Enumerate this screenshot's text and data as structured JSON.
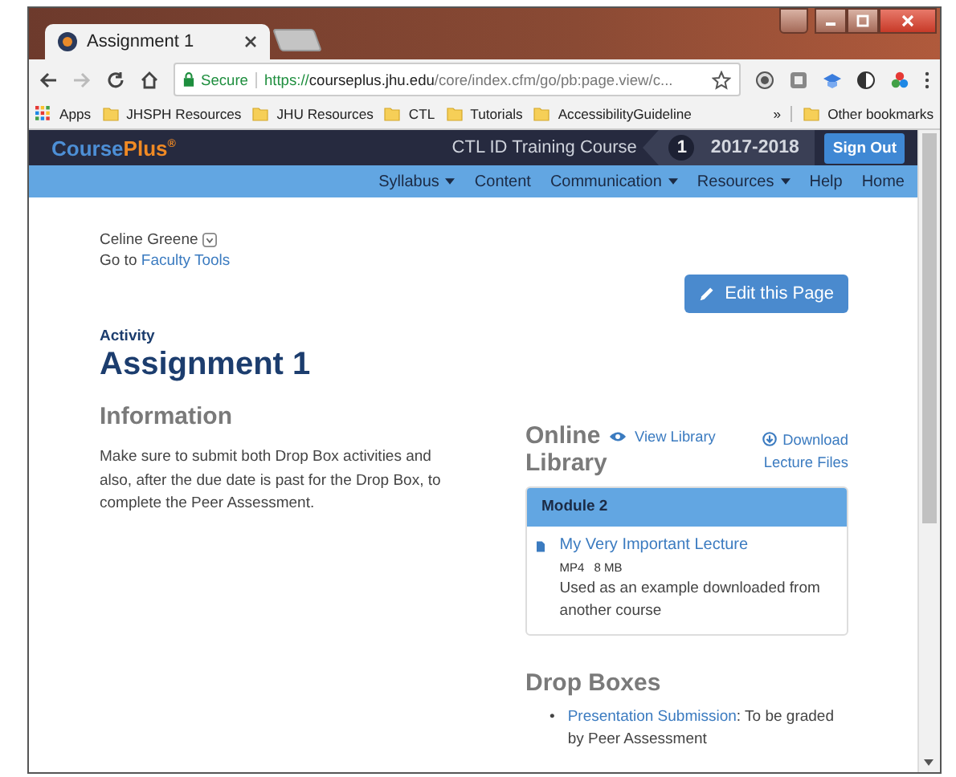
{
  "browser": {
    "tabs": [
      {
        "title": "Assignment 1",
        "selected": true
      },
      {
        "kind": "new",
        "selected": false
      }
    ],
    "address": {
      "secure_label": "Secure",
      "scheme": "https://",
      "host": "courseplus.jhu.edu",
      "path": "/core/index.cfm/go/pb:page.view/c..."
    },
    "bookmarks": [
      {
        "label": "Apps",
        "kind": "apps"
      },
      {
        "label": "JHSPH Resources",
        "kind": "folder"
      },
      {
        "label": "JHU Resources",
        "kind": "folder"
      },
      {
        "label": "CTL",
        "kind": "folder"
      },
      {
        "label": "Tutorials",
        "kind": "folder"
      },
      {
        "label": "AccessibilityGuideline",
        "kind": "folder"
      }
    ],
    "overflow": "»",
    "other_bookmarks": "Other bookmarks"
  },
  "site": {
    "logo": {
      "name": "Course",
      "accent": "Plus",
      "mark": "®"
    },
    "course": "CTL ID Training Course",
    "term_number": "1",
    "term": "2017-2018",
    "sign_out": "Sign Out",
    "nav": [
      {
        "label": "Syllabus",
        "dropdown": true
      },
      {
        "label": "Content",
        "dropdown": false
      },
      {
        "label": "Communication",
        "dropdown": true
      },
      {
        "label": "Resources",
        "dropdown": true
      },
      {
        "label": "Help",
        "dropdown": false
      },
      {
        "label": "Home",
        "dropdown": false
      }
    ]
  },
  "user": {
    "name": "Celine Greene",
    "goto_prefix": "Go to",
    "goto_link": "Faculty Tools"
  },
  "edit_button": "Edit this Page",
  "page": {
    "eyebrow": "Activity",
    "title": "Assignment 1",
    "info_heading": "Information",
    "info_text": "Make sure to submit both Drop Box activities and also, after the due date is past for the Drop Box, to complete the Peer Assessment."
  },
  "library": {
    "heading": "Online Library",
    "view_link": "View Library",
    "download_link": "Download Lecture Files",
    "module": {
      "title": "Module 2",
      "items": [
        {
          "title": "My Very Important Lecture",
          "format": "MP4",
          "size": "8 MB",
          "description": "Used as an example downloaded from another course"
        }
      ]
    }
  },
  "drop_boxes": {
    "heading": "Drop Boxes",
    "items": [
      {
        "bullet": "•",
        "link": "Presentation Submission",
        "text": ": To be graded by Peer Assessment"
      }
    ]
  }
}
